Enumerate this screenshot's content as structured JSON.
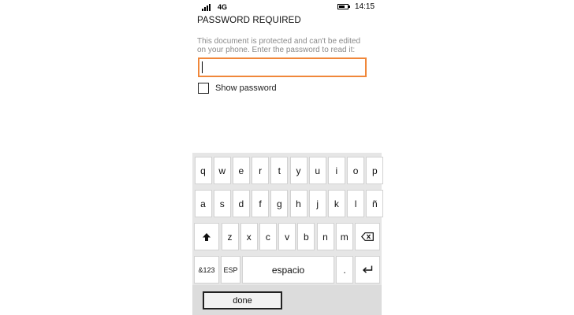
{
  "status_bar": {
    "network": "4G",
    "time": "14:15",
    "battery_level": 0.7
  },
  "dialog": {
    "title": "PASSWORD REQUIRED",
    "description": "This document is protected and can't be edited on your phone. Enter the password to read it:",
    "password_value": "",
    "show_password_label": "Show password",
    "show_password_checked": false
  },
  "keyboard": {
    "row1": [
      "q",
      "w",
      "e",
      "r",
      "t",
      "y",
      "u",
      "i",
      "o",
      "p"
    ],
    "row2": [
      "a",
      "s",
      "d",
      "f",
      "g",
      "h",
      "j",
      "k",
      "l",
      "ñ"
    ],
    "row3": [
      "z",
      "x",
      "c",
      "v",
      "b",
      "n",
      "m"
    ],
    "numbers_label": "&123",
    "language_label": "ESP",
    "space_label": "espacio",
    "period_label": ".",
    "done_label": "done"
  },
  "colors": {
    "focus_border": "#f0873a",
    "keyboard_bg": "#e6e6e6"
  }
}
